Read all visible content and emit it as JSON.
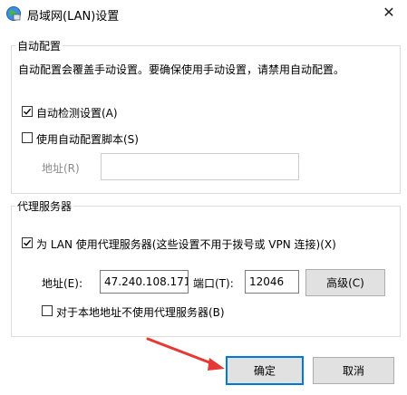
{
  "window": {
    "title": "局域网(LAN)设置",
    "close_label": "✕"
  },
  "auto_config": {
    "group_title": "自动配置",
    "description": "自动配置会覆盖手动设置。要确保使用手动设置，请禁用自动配置。",
    "auto_detect_label": "自动检测设置(A)",
    "auto_detect_checked": true,
    "use_script_label": "使用自动配置脚本(S)",
    "use_script_checked": false,
    "address_label": "地址(R)",
    "address_value": ""
  },
  "proxy": {
    "group_title": "代理服务器",
    "use_proxy_label": "为 LAN 使用代理服务器(这些设置不用于拨号或 VPN 连接)(X)",
    "use_proxy_checked": true,
    "address_label": "地址(E):",
    "address_value": "47.240.108.171",
    "port_label": "端口(T):",
    "port_value": "12046",
    "advanced_label": "高级(C)",
    "bypass_local_label": "对于本地地址不使用代理服务器(B)",
    "bypass_local_checked": false
  },
  "footer": {
    "ok_label": "确定",
    "cancel_label": "取消"
  },
  "colors": {
    "focus_border": "#0078d7",
    "annotation_arrow": "#e53935"
  }
}
